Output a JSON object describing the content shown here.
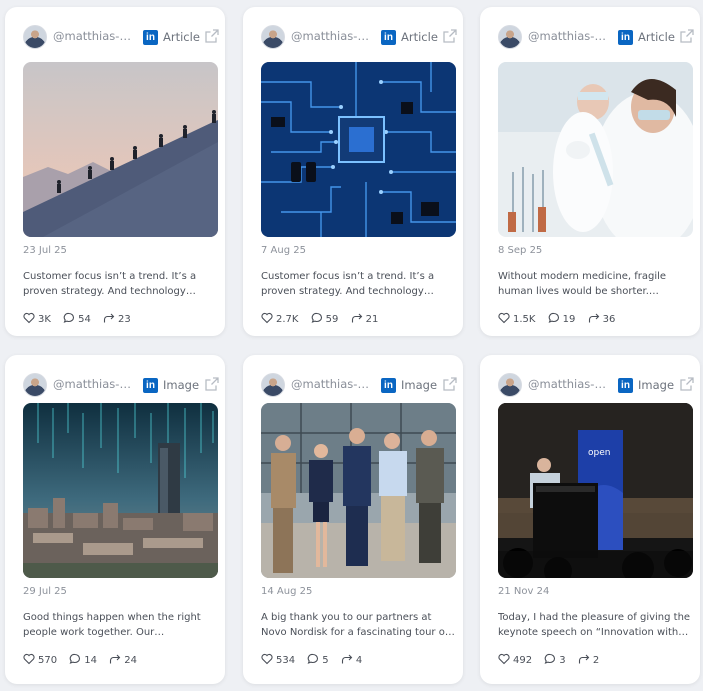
{
  "posts": [
    {
      "handle": "@matthias-re...",
      "network_icon": "linkedin-icon",
      "type": "Article",
      "image": "hikers-climbing-mountain-ridge-at-sunset",
      "date": "23 Jul 25",
      "text": "Customer focus isn’t a trend. It’s a proven strategy. And technology companies…",
      "likes": "3K",
      "comments": "54",
      "shares": "23"
    },
    {
      "handle": "@matthias-re...",
      "network_icon": "linkedin-icon",
      "type": "Article",
      "image": "blue-circuit-board-with-chip",
      "date": "7 Aug 25",
      "text": "Customer focus isn’t a trend. It’s a proven strategy. And technology companies…",
      "likes": "2.7K",
      "comments": "59",
      "shares": "21"
    },
    {
      "handle": "@matthias-re...",
      "network_icon": "linkedin-icon",
      "type": "Article",
      "image": "scientists-in-laboratory-with-test-tubes",
      "date": "8 Sep 25",
      "text": "Without modern medicine, fragile human lives would be shorter. Resilience in life…",
      "likes": "1.5K",
      "comments": "19",
      "shares": "36"
    },
    {
      "handle": "@matthias-re...",
      "network_icon": "linkedin-icon",
      "type": "Image",
      "image": "city-skyline-with-digital-rain",
      "date": "29 Jul 25",
      "text": "Good things happen when the right people work together. Our collaboration…",
      "likes": "570",
      "comments": "14",
      "shares": "24"
    },
    {
      "handle": "@matthias-re...",
      "network_icon": "linkedin-icon",
      "type": "Image",
      "image": "group-photo-of-five-people-outside-building",
      "date": "14 Aug 25",
      "text": "A big thank you to our partners at Novo Nordisk for a fascinating tour of the site…",
      "likes": "534",
      "comments": "5",
      "shares": "4"
    },
    {
      "handle": "@matthias-re...",
      "network_icon": "linkedin-icon",
      "type": "Image",
      "image": "speaker-at-podium-on-stage",
      "image_text": "open",
      "date": "21 Nov 24",
      "text": "Today, I had the pleasure of giving the keynote speech on “Innovation with…",
      "likes": "492",
      "comments": "3",
      "shares": "2"
    }
  ],
  "icons": {
    "like": "heart-icon",
    "comment": "comment-icon",
    "share": "share-icon",
    "external": "external-link-icon",
    "network_letters": "in"
  },
  "colors": {
    "linkedin": "#0a66c2",
    "background": "#eef0f4",
    "card": "#ffffff"
  }
}
